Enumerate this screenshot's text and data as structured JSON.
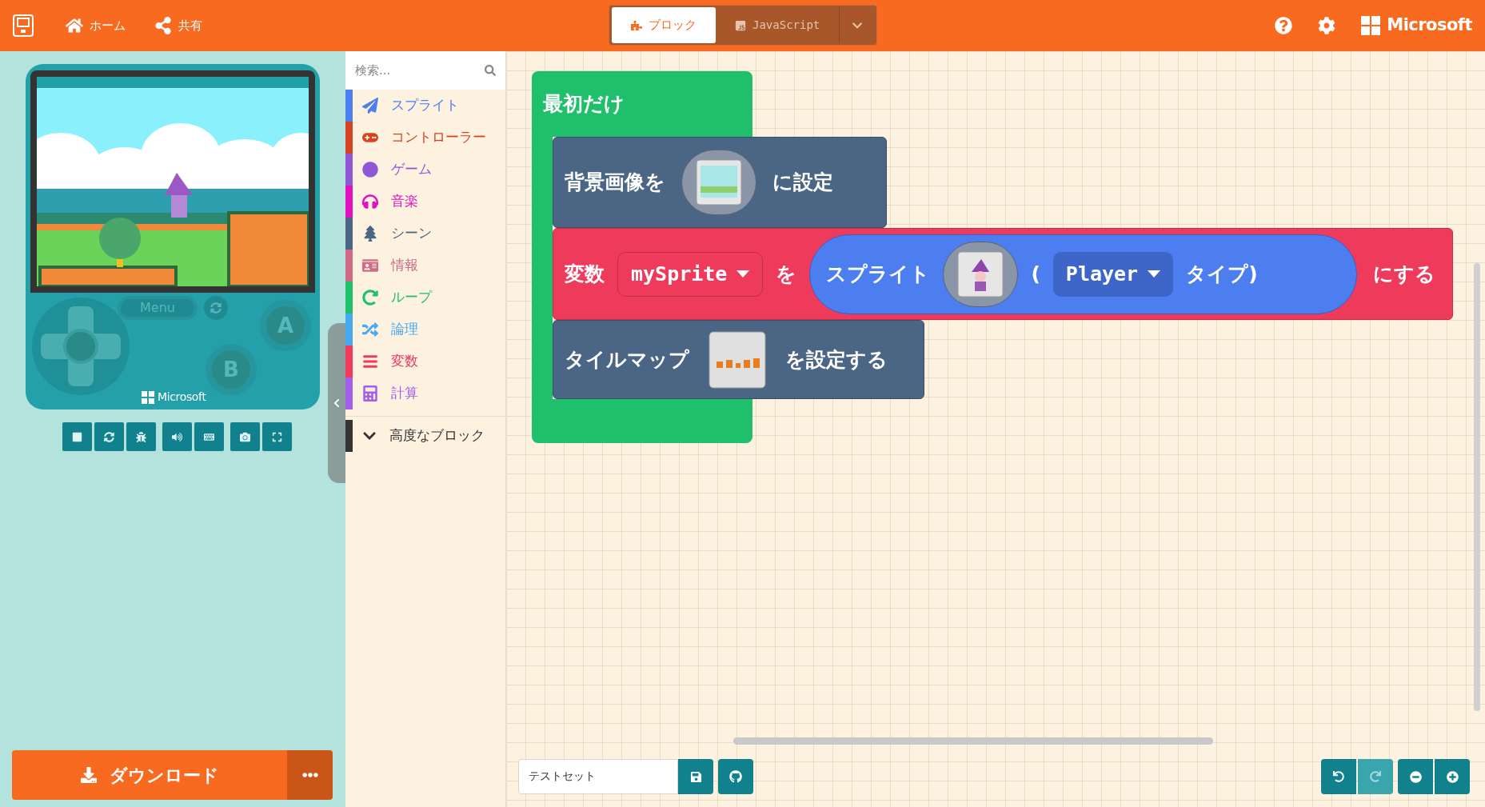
{
  "header": {
    "nav": [
      {
        "label": "ホーム"
      },
      {
        "label": "共有"
      }
    ],
    "editor_tabs": [
      {
        "label": "ブロック",
        "selected": true
      },
      {
        "label": "JavaScript",
        "selected": false
      }
    ],
    "brand": "Microsoft"
  },
  "simulator": {
    "menu": "Menu",
    "button_a": "A",
    "button_b": "B",
    "brand": "Microsoft"
  },
  "download": {
    "label": "ダウンロード"
  },
  "toolbox": {
    "search": {
      "placeholder": "検索..."
    },
    "categories": [
      {
        "label": "スプライト",
        "color": "#4c7ef0"
      },
      {
        "label": "コントローラー",
        "color": "#d54322"
      },
      {
        "label": "ゲーム",
        "color": "#8f57d6"
      },
      {
        "label": "音楽",
        "color": "#e30fc0"
      },
      {
        "label": "シーン",
        "color": "#4b6584"
      },
      {
        "label": "情報",
        "color": "#cf6a87"
      },
      {
        "label": "ループ",
        "color": "#20bf6b"
      },
      {
        "label": "論理",
        "color": "#45aaf2"
      },
      {
        "label": "変数",
        "color": "#ee3b5c"
      },
      {
        "label": "計算",
        "color": "#a55eea"
      }
    ],
    "advanced": {
      "label": "高度なブロック"
    }
  },
  "workspace": {
    "hat": "最初だけ",
    "background": {
      "label": "背景画像を",
      "suffix": "に設定"
    },
    "variable": {
      "label": "変数",
      "name": "mySprite",
      "to": "を",
      "sprite": {
        "label": "スプライト",
        "open": "(",
        "kind": "Player",
        "close": "タイプ)"
      },
      "suffix": "にする"
    },
    "tilemap": {
      "label": "タイルマップ",
      "suffix": "を設定する"
    }
  },
  "project": {
    "name": "テストセット"
  }
}
